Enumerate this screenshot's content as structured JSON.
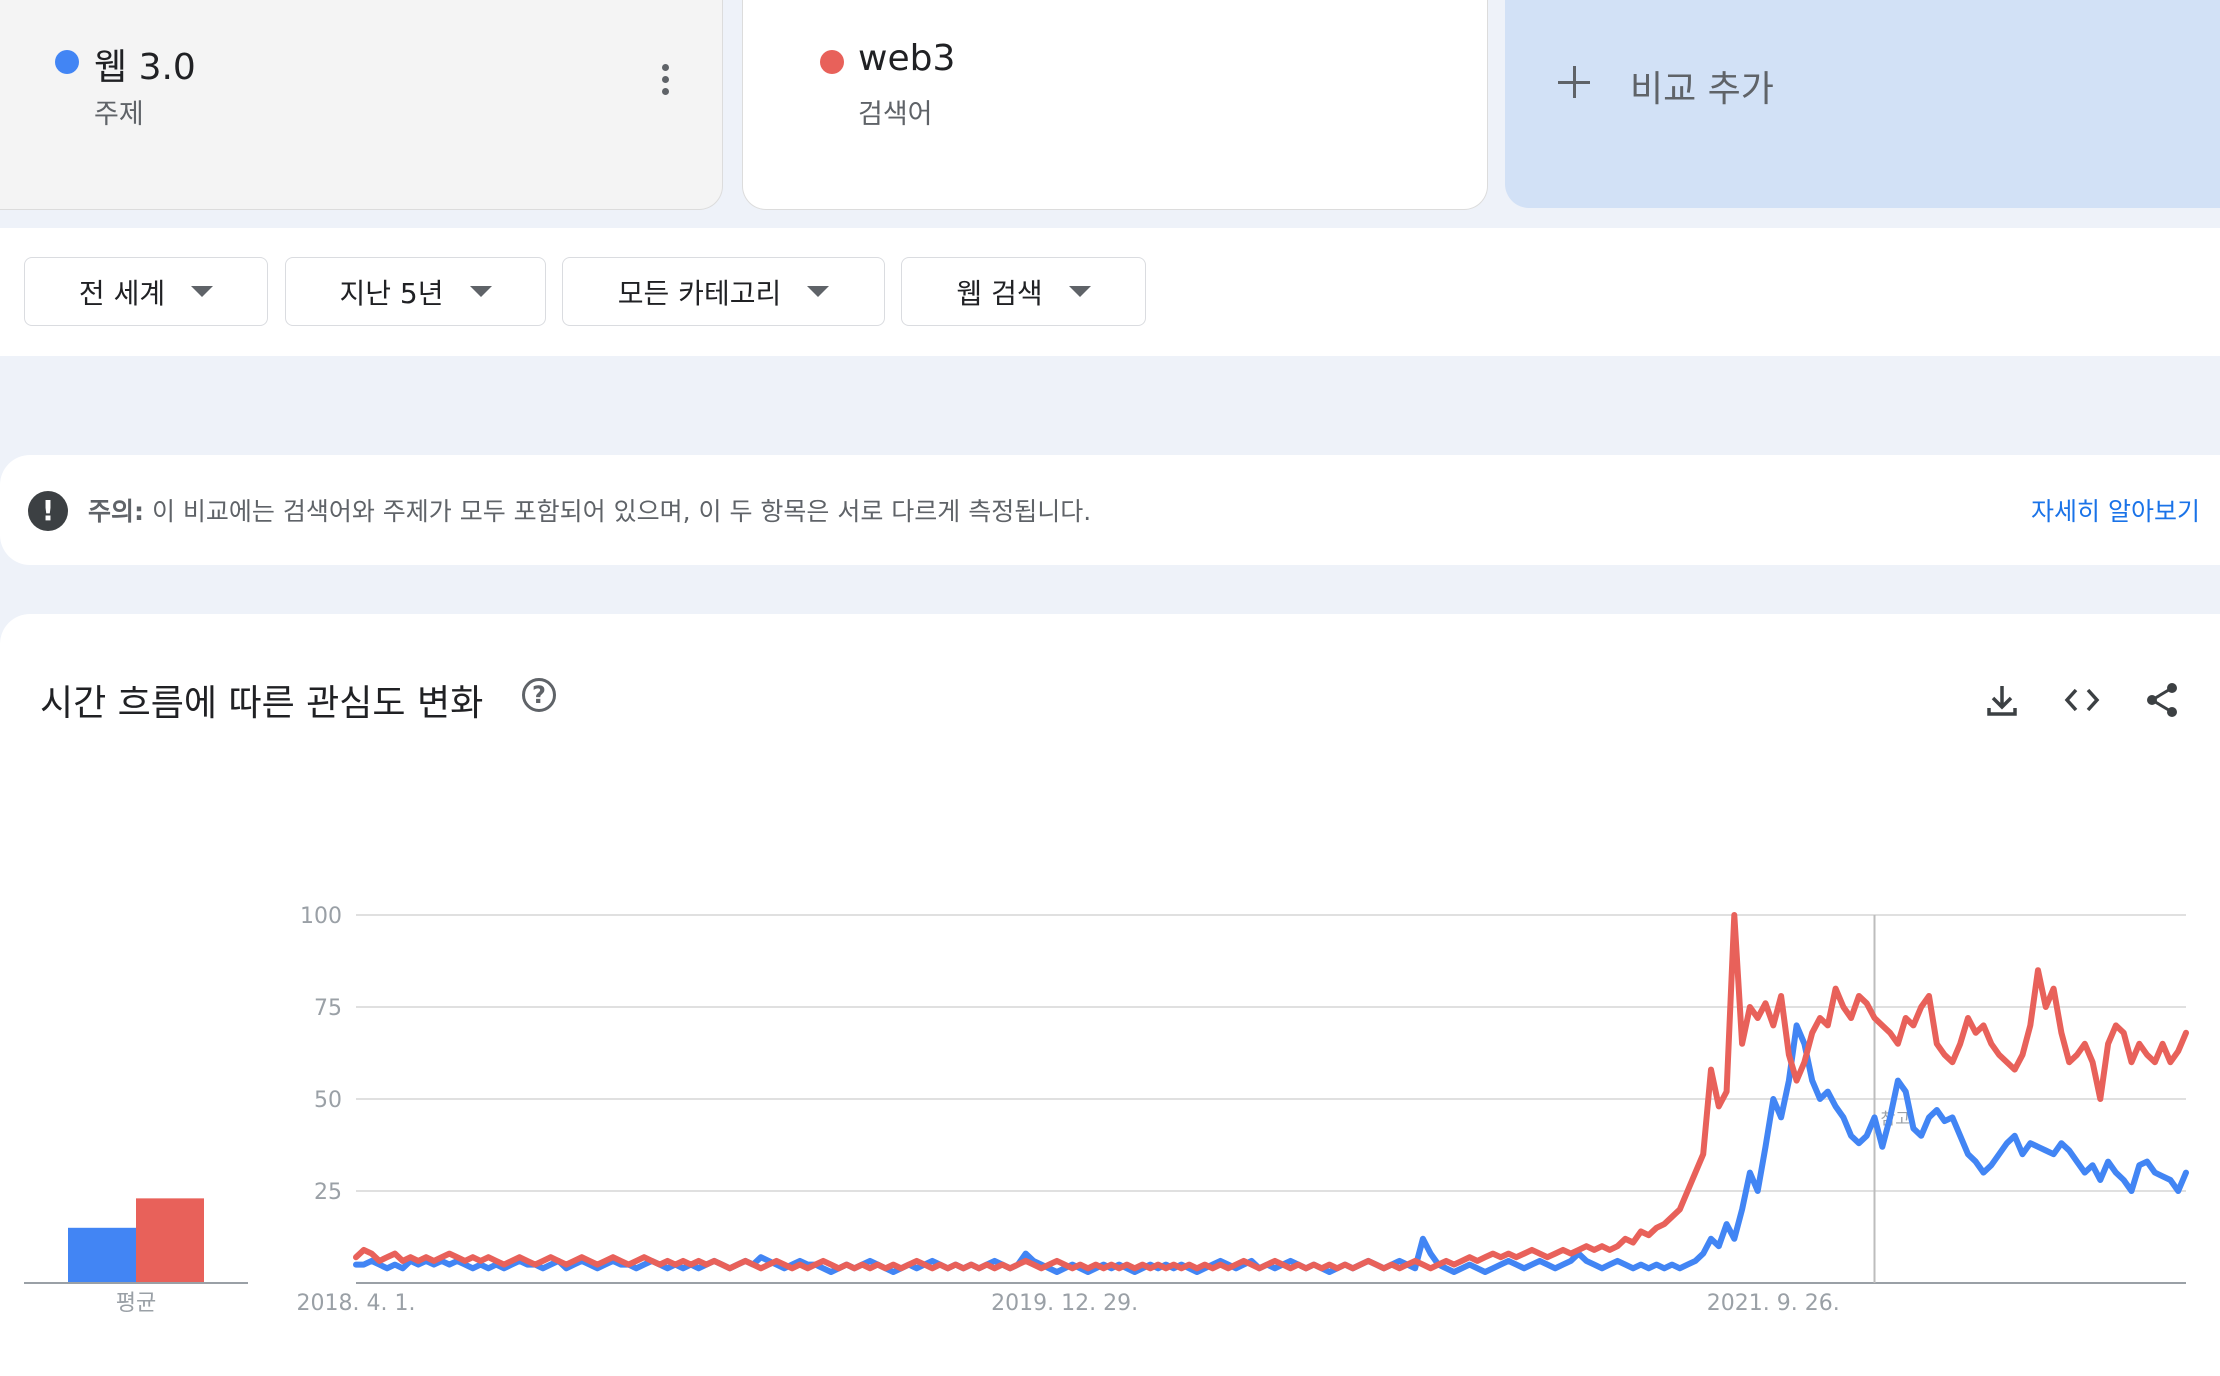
{
  "compare": {
    "terms": [
      {
        "name": "웹 3.0",
        "type": "주제",
        "color": "#4285f4"
      },
      {
        "name": "web3",
        "type": "검색어",
        "color": "#e8615a"
      }
    ],
    "add_label": "비교 추가"
  },
  "filters": [
    {
      "label": "전 세계"
    },
    {
      "label": "지난 5년"
    },
    {
      "label": "모든 카테고리"
    },
    {
      "label": "웹 검색"
    }
  ],
  "notice": {
    "prefix": "주의:",
    "text": " 이 비교에는 검색어와 주제가 모두 포함되어 있으며, 이 두 항목은 서로 다르게 측정됩니다.",
    "link": "자세히 알아보기"
  },
  "chart_panel": {
    "title": "시간 흐름에 따른 관심도 변화",
    "icons": [
      "download-icon",
      "embed-code-icon",
      "share-icon"
    ]
  },
  "chart_data": {
    "type": "line",
    "yticks": [
      25,
      50,
      75,
      100
    ],
    "ylim": [
      0,
      100
    ],
    "xtick_labels": [
      "2018. 4. 1.",
      "2019. 12. 29.",
      "2021. 9. 26."
    ],
    "xtick_index": [
      0,
      91,
      182
    ],
    "annotation_index": [
      195
    ],
    "annotation_label": "참고",
    "average_label": "평균",
    "averages": [
      {
        "name": "웹 3.0",
        "value": 15
      },
      {
        "name": "web3",
        "value": 23
      }
    ],
    "series": [
      {
        "name": "웹 3.0",
        "color": "#4285f4",
        "values": [
          5,
          5,
          6,
          5,
          4,
          5,
          4,
          6,
          5,
          6,
          5,
          6,
          5,
          6,
          5,
          4,
          5,
          4,
          5,
          4,
          5,
          6,
          5,
          5,
          4,
          5,
          6,
          4,
          5,
          6,
          5,
          4,
          5,
          6,
          5,
          5,
          4,
          5,
          6,
          5,
          4,
          5,
          4,
          5,
          4,
          5,
          6,
          5,
          4,
          5,
          6,
          5,
          7,
          6,
          5,
          4,
          5,
          6,
          5,
          5,
          4,
          3,
          4,
          5,
          4,
          5,
          6,
          5,
          4,
          3,
          4,
          5,
          4,
          5,
          6,
          5,
          4,
          5,
          4,
          5,
          4,
          5,
          6,
          5,
          4,
          5,
          8,
          6,
          5,
          4,
          3,
          4,
          5,
          4,
          3,
          4,
          5,
          4,
          5,
          4,
          3,
          4,
          5,
          4,
          5,
          4,
          5,
          4,
          3,
          4,
          5,
          6,
          5,
          4,
          5,
          6,
          4,
          5,
          4,
          5,
          6,
          5,
          4,
          5,
          4,
          3,
          4,
          5,
          4,
          5,
          6,
          5,
          4,
          5,
          6,
          5,
          4,
          12,
          8,
          5,
          4,
          3,
          4,
          5,
          4,
          3,
          4,
          5,
          6,
          5,
          4,
          5,
          6,
          5,
          4,
          5,
          6,
          8,
          6,
          5,
          4,
          5,
          6,
          5,
          4,
          5,
          4,
          5,
          4,
          5,
          4,
          5,
          6,
          8,
          12,
          10,
          16,
          12,
          20,
          30,
          25,
          37,
          50,
          45,
          55,
          70,
          65,
          55,
          50,
          52,
          48,
          45,
          40,
          38,
          40,
          45,
          37,
          45,
          55,
          52,
          42,
          40,
          45,
          47,
          44,
          45,
          40,
          35,
          33,
          30,
          32,
          35,
          38,
          40,
          35,
          38,
          37,
          36,
          35,
          38,
          36,
          33,
          30,
          32,
          28,
          33,
          30,
          28,
          25,
          32,
          33,
          30,
          29,
          28,
          25,
          30
        ]
      },
      {
        "name": "web3",
        "color": "#e8615a",
        "values": [
          7,
          9,
          8,
          6,
          7,
          8,
          6,
          7,
          6,
          7,
          6,
          7,
          8,
          7,
          6,
          7,
          6,
          7,
          6,
          5,
          6,
          7,
          6,
          5,
          6,
          7,
          6,
          5,
          6,
          7,
          6,
          5,
          6,
          7,
          6,
          5,
          6,
          7,
          6,
          5,
          6,
          5,
          6,
          5,
          6,
          5,
          6,
          5,
          4,
          5,
          6,
          5,
          4,
          5,
          6,
          5,
          4,
          5,
          4,
          5,
          6,
          5,
          4,
          5,
          4,
          5,
          4,
          5,
          4,
          5,
          4,
          5,
          6,
          5,
          4,
          5,
          4,
          5,
          4,
          5,
          4,
          5,
          4,
          5,
          4,
          5,
          6,
          5,
          4,
          5,
          6,
          5,
          4,
          5,
          4,
          5,
          4,
          5,
          4,
          5,
          4,
          5,
          4,
          5,
          4,
          5,
          4,
          5,
          4,
          5,
          4,
          5,
          4,
          5,
          6,
          5,
          4,
          5,
          6,
          5,
          4,
          5,
          4,
          5,
          4,
          5,
          4,
          5,
          4,
          5,
          6,
          5,
          4,
          5,
          4,
          5,
          6,
          5,
          4,
          5,
          6,
          5,
          6,
          7,
          6,
          7,
          8,
          7,
          8,
          7,
          8,
          9,
          8,
          7,
          8,
          9,
          8,
          9,
          10,
          9,
          10,
          9,
          10,
          12,
          11,
          14,
          13,
          15,
          16,
          18,
          20,
          25,
          30,
          35,
          58,
          48,
          52,
          100,
          65,
          75,
          72,
          76,
          70,
          78,
          62,
          55,
          60,
          68,
          72,
          70,
          80,
          75,
          72,
          78,
          76,
          72,
          70,
          68,
          65,
          72,
          70,
          75,
          78,
          65,
          62,
          60,
          65,
          72,
          68,
          70,
          65,
          62,
          60,
          58,
          62,
          70,
          85,
          75,
          80,
          68,
          60,
          62,
          65,
          60,
          50,
          65,
          70,
          68,
          60,
          65,
          62,
          60,
          65,
          60,
          63,
          68
        ]
      }
    ]
  }
}
